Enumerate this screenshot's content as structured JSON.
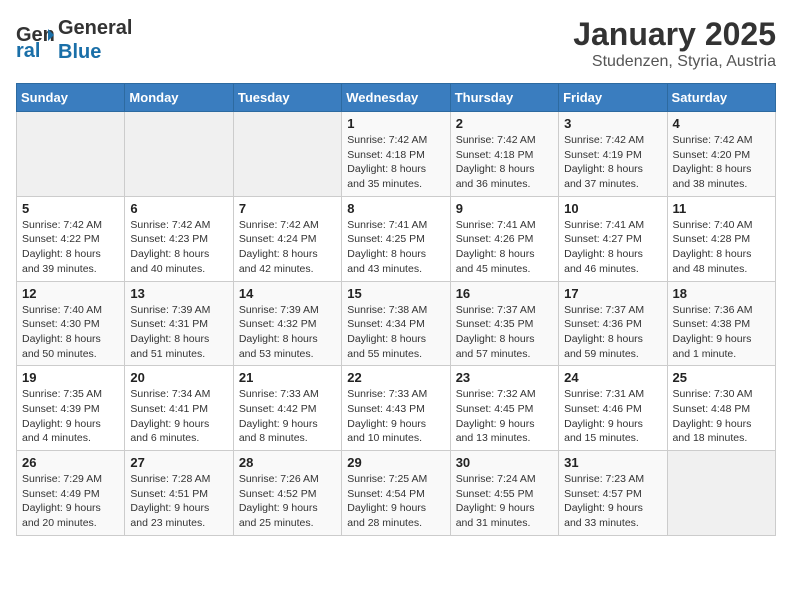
{
  "header": {
    "logo_line1": "General",
    "logo_line2": "Blue",
    "title": "January 2025",
    "subtitle": "Studenzen, Styria, Austria"
  },
  "weekdays": [
    "Sunday",
    "Monday",
    "Tuesday",
    "Wednesday",
    "Thursday",
    "Friday",
    "Saturday"
  ],
  "weeks": [
    [
      {
        "day": "",
        "info": ""
      },
      {
        "day": "",
        "info": ""
      },
      {
        "day": "",
        "info": ""
      },
      {
        "day": "1",
        "info": "Sunrise: 7:42 AM\nSunset: 4:18 PM\nDaylight: 8 hours and 35 minutes."
      },
      {
        "day": "2",
        "info": "Sunrise: 7:42 AM\nSunset: 4:18 PM\nDaylight: 8 hours and 36 minutes."
      },
      {
        "day": "3",
        "info": "Sunrise: 7:42 AM\nSunset: 4:19 PM\nDaylight: 8 hours and 37 minutes."
      },
      {
        "day": "4",
        "info": "Sunrise: 7:42 AM\nSunset: 4:20 PM\nDaylight: 8 hours and 38 minutes."
      }
    ],
    [
      {
        "day": "5",
        "info": "Sunrise: 7:42 AM\nSunset: 4:22 PM\nDaylight: 8 hours and 39 minutes."
      },
      {
        "day": "6",
        "info": "Sunrise: 7:42 AM\nSunset: 4:23 PM\nDaylight: 8 hours and 40 minutes."
      },
      {
        "day": "7",
        "info": "Sunrise: 7:42 AM\nSunset: 4:24 PM\nDaylight: 8 hours and 42 minutes."
      },
      {
        "day": "8",
        "info": "Sunrise: 7:41 AM\nSunset: 4:25 PM\nDaylight: 8 hours and 43 minutes."
      },
      {
        "day": "9",
        "info": "Sunrise: 7:41 AM\nSunset: 4:26 PM\nDaylight: 8 hours and 45 minutes."
      },
      {
        "day": "10",
        "info": "Sunrise: 7:41 AM\nSunset: 4:27 PM\nDaylight: 8 hours and 46 minutes."
      },
      {
        "day": "11",
        "info": "Sunrise: 7:40 AM\nSunset: 4:28 PM\nDaylight: 8 hours and 48 minutes."
      }
    ],
    [
      {
        "day": "12",
        "info": "Sunrise: 7:40 AM\nSunset: 4:30 PM\nDaylight: 8 hours and 50 minutes."
      },
      {
        "day": "13",
        "info": "Sunrise: 7:39 AM\nSunset: 4:31 PM\nDaylight: 8 hours and 51 minutes."
      },
      {
        "day": "14",
        "info": "Sunrise: 7:39 AM\nSunset: 4:32 PM\nDaylight: 8 hours and 53 minutes."
      },
      {
        "day": "15",
        "info": "Sunrise: 7:38 AM\nSunset: 4:34 PM\nDaylight: 8 hours and 55 minutes."
      },
      {
        "day": "16",
        "info": "Sunrise: 7:37 AM\nSunset: 4:35 PM\nDaylight: 8 hours and 57 minutes."
      },
      {
        "day": "17",
        "info": "Sunrise: 7:37 AM\nSunset: 4:36 PM\nDaylight: 8 hours and 59 minutes."
      },
      {
        "day": "18",
        "info": "Sunrise: 7:36 AM\nSunset: 4:38 PM\nDaylight: 9 hours and 1 minute."
      }
    ],
    [
      {
        "day": "19",
        "info": "Sunrise: 7:35 AM\nSunset: 4:39 PM\nDaylight: 9 hours and 4 minutes."
      },
      {
        "day": "20",
        "info": "Sunrise: 7:34 AM\nSunset: 4:41 PM\nDaylight: 9 hours and 6 minutes."
      },
      {
        "day": "21",
        "info": "Sunrise: 7:33 AM\nSunset: 4:42 PM\nDaylight: 9 hours and 8 minutes."
      },
      {
        "day": "22",
        "info": "Sunrise: 7:33 AM\nSunset: 4:43 PM\nDaylight: 9 hours and 10 minutes."
      },
      {
        "day": "23",
        "info": "Sunrise: 7:32 AM\nSunset: 4:45 PM\nDaylight: 9 hours and 13 minutes."
      },
      {
        "day": "24",
        "info": "Sunrise: 7:31 AM\nSunset: 4:46 PM\nDaylight: 9 hours and 15 minutes."
      },
      {
        "day": "25",
        "info": "Sunrise: 7:30 AM\nSunset: 4:48 PM\nDaylight: 9 hours and 18 minutes."
      }
    ],
    [
      {
        "day": "26",
        "info": "Sunrise: 7:29 AM\nSunset: 4:49 PM\nDaylight: 9 hours and 20 minutes."
      },
      {
        "day": "27",
        "info": "Sunrise: 7:28 AM\nSunset: 4:51 PM\nDaylight: 9 hours and 23 minutes."
      },
      {
        "day": "28",
        "info": "Sunrise: 7:26 AM\nSunset: 4:52 PM\nDaylight: 9 hours and 25 minutes."
      },
      {
        "day": "29",
        "info": "Sunrise: 7:25 AM\nSunset: 4:54 PM\nDaylight: 9 hours and 28 minutes."
      },
      {
        "day": "30",
        "info": "Sunrise: 7:24 AM\nSunset: 4:55 PM\nDaylight: 9 hours and 31 minutes."
      },
      {
        "day": "31",
        "info": "Sunrise: 7:23 AM\nSunset: 4:57 PM\nDaylight: 9 hours and 33 minutes."
      },
      {
        "day": "",
        "info": ""
      }
    ]
  ]
}
